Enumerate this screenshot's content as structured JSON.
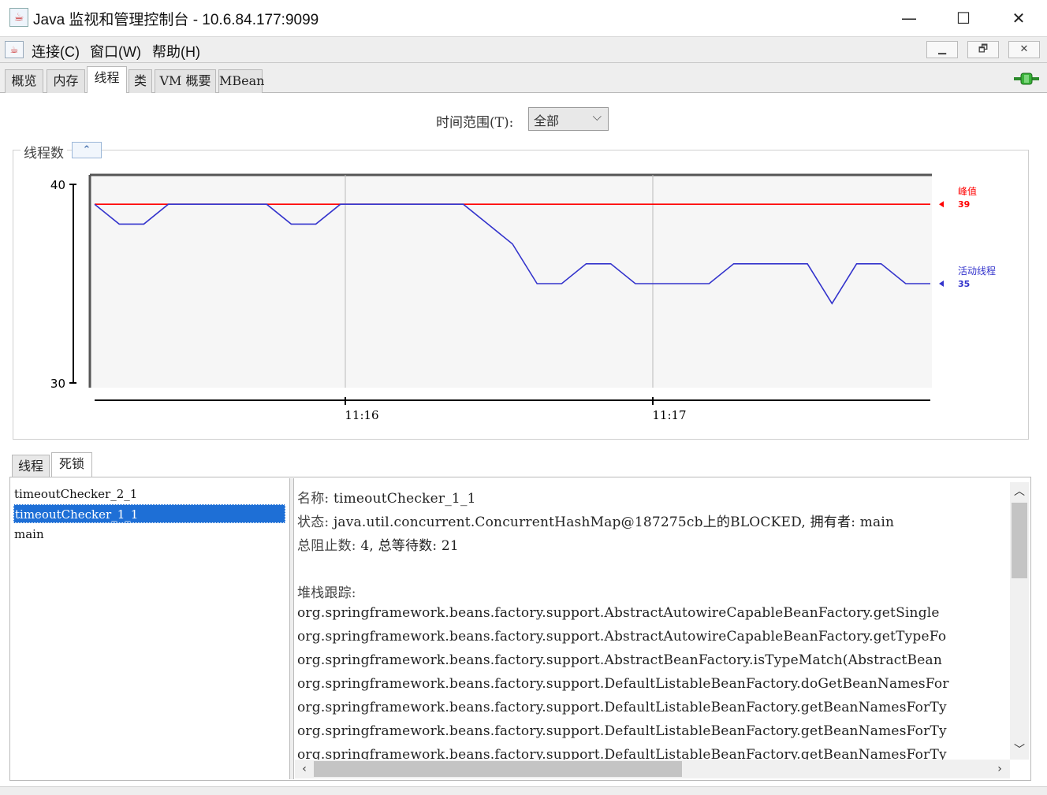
{
  "window": {
    "title": "Java 监视和管理控制台 - 10.6.84.177:9099",
    "controls": [
      "—",
      "☐",
      "✕"
    ]
  },
  "menu": {
    "items": [
      "连接(C)",
      "窗口(W)",
      "帮助(H)"
    ],
    "mdi_buttons": [
      "▁",
      "🗗",
      "✕"
    ]
  },
  "tabs": [
    "概览",
    "内存",
    "线程",
    "类",
    "VM 概要",
    "MBean"
  ],
  "active_tab": "线程",
  "time_range": {
    "label": "时间范围(T):",
    "value": "全部"
  },
  "chart_panel": {
    "title": "线程数"
  },
  "chart_data": {
    "type": "line",
    "ylim": [
      30,
      40
    ],
    "y_ticks": [
      "40",
      "30"
    ],
    "x_ticks": [
      "11:16",
      "11:17"
    ],
    "series": [
      {
        "name": "峰值",
        "color": "#ff0000",
        "current": "39",
        "values": [
          39,
          39,
          39,
          39,
          39,
          39,
          39,
          39,
          39,
          39,
          39,
          39,
          39,
          39,
          39,
          39,
          39,
          39,
          39,
          39,
          39,
          39,
          39,
          39,
          39,
          39,
          39,
          39,
          39,
          39,
          39,
          39,
          39,
          39,
          39
        ]
      },
      {
        "name": "活动线程",
        "color": "#3333cc",
        "current": "35",
        "values": [
          39,
          38,
          38,
          39,
          39,
          39,
          39,
          39,
          38,
          38,
          39,
          39,
          39,
          39,
          39,
          39,
          38,
          37,
          35,
          35,
          36,
          36,
          35,
          35,
          35,
          35,
          36,
          36,
          36,
          36,
          34,
          36,
          36,
          35,
          35
        ]
      }
    ]
  },
  "subtabs": [
    "线程",
    "死锁"
  ],
  "active_subtab": "死锁",
  "threads": [
    "timeoutChecker_2_1",
    "timeoutChecker_1_1",
    "main"
  ],
  "selected_thread": "timeoutChecker_1_1",
  "detail": {
    "name_label": "名称:",
    "name_value": "timeoutChecker_1_1",
    "state_label": "状态:",
    "state_value": "java.util.concurrent.ConcurrentHashMap@187275cb上的BLOCKED, 拥有者: main",
    "counts_label": "总阻止数:",
    "counts_value": "4, 总等待数: 21",
    "stack_label": "堆栈跟踪:",
    "stack": [
      "org.springframework.beans.factory.support.AbstractAutowireCapableBeanFactory.getSingle",
      "org.springframework.beans.factory.support.AbstractAutowireCapableBeanFactory.getTypeFo",
      "org.springframework.beans.factory.support.AbstractBeanFactory.isTypeMatch(AbstractBean",
      "org.springframework.beans.factory.support.DefaultListableBeanFactory.doGetBeanNamesFor",
      "org.springframework.beans.factory.support.DefaultListableBeanFactory.getBeanNamesForTy",
      "org.springframework.beans.factory.support.DefaultListableBeanFactory.getBeanNamesForTy",
      "org.springframework.beans.factory.support.DefaultListableBeanFactory.getBeanNamesForTy"
    ]
  }
}
